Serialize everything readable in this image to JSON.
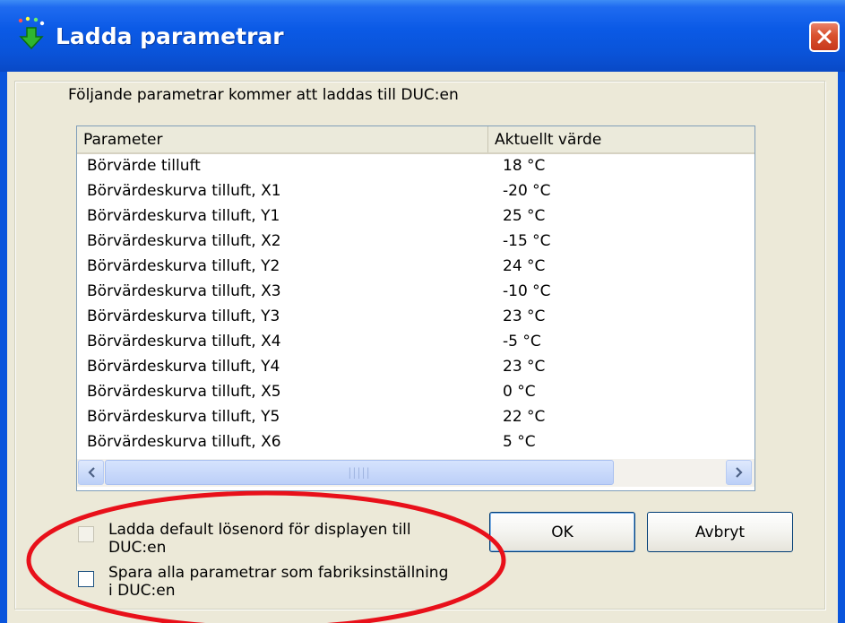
{
  "window": {
    "title": "Ladda parametrar"
  },
  "intro_text": "Följande parametrar kommer att laddas till DUC:en",
  "list": {
    "columns": [
      "Parameter",
      "Aktuellt värde"
    ],
    "rows": [
      {
        "name": "Börvärde tilluft",
        "value": "18 °C"
      },
      {
        "name": "Börvärdeskurva tilluft, X1",
        "value": "-20 °C"
      },
      {
        "name": "Börvärdeskurva tilluft, Y1",
        "value": "25 °C"
      },
      {
        "name": "Börvärdeskurva tilluft, X2",
        "value": "-15 °C"
      },
      {
        "name": "Börvärdeskurva tilluft, Y2",
        "value": "24 °C"
      },
      {
        "name": "Börvärdeskurva tilluft, X3",
        "value": "-10 °C"
      },
      {
        "name": "Börvärdeskurva tilluft, Y3",
        "value": "23 °C"
      },
      {
        "name": "Börvärdeskurva tilluft, X4",
        "value": "-5 °C"
      },
      {
        "name": "Börvärdeskurva tilluft, Y4",
        "value": "23 °C"
      },
      {
        "name": "Börvärdeskurva tilluft, X5",
        "value": "0 °C"
      },
      {
        "name": "Börvärdeskurva tilluft, Y5",
        "value": "22 °C"
      },
      {
        "name": "Börvärdeskurva tilluft, X6",
        "value": "5 °C"
      }
    ]
  },
  "options": {
    "default_password": {
      "label_line1": "Ladda default lösenord för displayen till",
      "label_line2": "DUC:en",
      "checked": false,
      "enabled": false
    },
    "factory_settings": {
      "label_line1": "Spara alla parametrar som fabriksinställning",
      "label_line2": "i DUC:en",
      "checked": false,
      "enabled": true
    }
  },
  "buttons": {
    "ok": "OK",
    "cancel": "Avbryt"
  },
  "icons": {
    "title": "download-arrow-icon",
    "close": "close-icon"
  },
  "colors": {
    "titlebar": "#0a53d8",
    "close_button": "#d9512e",
    "annotation": "#e8101a",
    "dialog_bg": "#ece9d8"
  }
}
